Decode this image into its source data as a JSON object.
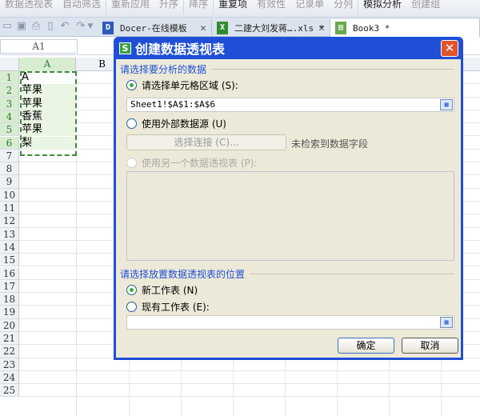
{
  "ribbon": {
    "items": [
      "数据透视表",
      "自动筛选",
      "重新应用",
      "升序",
      "降序",
      "重复项",
      "有效性",
      "记录单",
      "分列",
      "模拟分析",
      "创建组"
    ]
  },
  "tabs": [
    {
      "label": "Docer-在线模板"
    },
    {
      "label": "二建大刘发蒋….xls *"
    },
    {
      "label": "Book3 *"
    }
  ],
  "formula": {
    "namebox": "A1"
  },
  "columns": [
    "A",
    "B"
  ],
  "rows": [
    "1",
    "2",
    "3",
    "4",
    "5",
    "6",
    "7",
    "8",
    "9",
    "10",
    "11",
    "12",
    "13",
    "14",
    "15",
    "16",
    "17",
    "18",
    "19",
    "20",
    "21",
    "22",
    "23",
    "24",
    "25"
  ],
  "cells": [
    "A",
    "苹果",
    "苹果",
    "香蕉",
    "苹果",
    "梨"
  ],
  "dialog": {
    "title": "创建数据透视表",
    "close": "✕",
    "group1": "请选择要分析的数据",
    "opt_range": "请选择单元格区域 (S):",
    "range_value": "Sheet1!$A$1:$A$6",
    "opt_external": "使用外部数据源 (U)",
    "select_conn": "选择连接 (C)...",
    "no_fields": "未检索到数据字段",
    "opt_other": "使用另一个数据透视表 (P):",
    "group2": "请选择放置数据透视表的位置",
    "opt_new": "新工作表 (N)",
    "opt_existing": "现有工作表 (E):",
    "existing_value": "",
    "ok": "确定",
    "cancel": "取消"
  }
}
